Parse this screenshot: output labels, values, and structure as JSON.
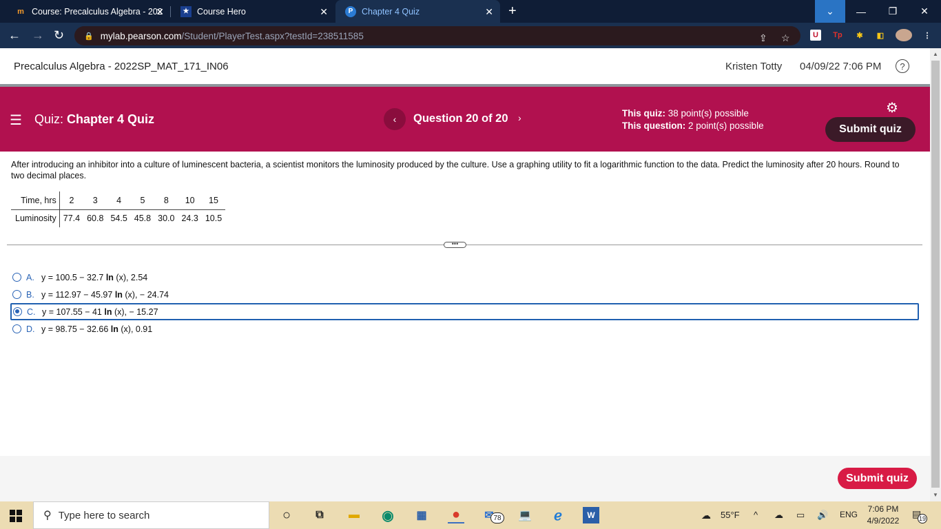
{
  "browser": {
    "tabs": [
      {
        "label": "Course: Precalculus Algebra - 202",
        "icon": "mylab-icon",
        "fav": "m"
      },
      {
        "label": "Course Hero",
        "icon": "coursehero-icon",
        "fav": "★"
      },
      {
        "label": "Chapter 4 Quiz",
        "icon": "pearson-icon",
        "fav": "P"
      }
    ],
    "url_host": "mylab.pearson.com",
    "url_path": "/Student/PlayerTest.aspx?testId=238511585"
  },
  "header": {
    "course_title": "Precalculus Algebra - 2022SP_MAT_171_IN06",
    "user_name": "Kristen Totty",
    "datetime": "04/09/22 7:06 PM"
  },
  "banner": {
    "quiz_prefix": "Quiz:",
    "quiz_name": "Chapter 4 Quiz",
    "question_counter": "Question 20 of 20",
    "this_quiz_label": "This quiz:",
    "this_quiz_value": "38 point(s) possible",
    "this_question_label": "This question:",
    "this_question_value": "2 point(s) possible",
    "submit_label": "Submit quiz",
    "colors": {
      "banner": "#b1114f",
      "submit_button": "#3b1a28"
    }
  },
  "question": {
    "text": "After introducing an inhibitor into a culture of luminescent bacteria, a scientist monitors the luminosity produced by the culture. Use a graphing utility to fit a logarithmic function to the data. Predict the luminosity after 20 hours. Round to two decimal places.",
    "table": {
      "row1_label": "Time, hrs",
      "row1_values": [
        "2",
        "3",
        "4",
        "5",
        "8",
        "10",
        "15"
      ],
      "row2_label": "Luminosity",
      "row2_values": [
        "77.4",
        "60.8",
        "54.5",
        "45.8",
        "30.0",
        "24.3",
        "10.5"
      ]
    }
  },
  "options": [
    {
      "letter": "A.",
      "pre": "y = 100.5 − 32.7 ",
      "ln": "ln",
      "post": " (x),  2.54",
      "selected": false
    },
    {
      "letter": "B.",
      "pre": "y = 112.97 − 45.97 ",
      "ln": "ln",
      "post": " (x),  − 24.74",
      "selected": false
    },
    {
      "letter": "C.",
      "pre": "y = 107.55 − 41 ",
      "ln": "ln",
      "post": " (x),  − 15.27",
      "selected": true
    },
    {
      "letter": "D.",
      "pre": "y = 98.75 − 32.66 ",
      "ln": "ln",
      "post": " (x), 0.91",
      "selected": false
    }
  ],
  "footer": {
    "submit_label": "Submit quiz",
    "submit_color": "#d81b45"
  },
  "taskbar": {
    "search_placeholder": "Type here to search",
    "weather": "55°F",
    "language": "ENG",
    "time": "7:06 PM",
    "date": "4/9/2022",
    "mail_badge": "78",
    "notification_count": "19"
  }
}
